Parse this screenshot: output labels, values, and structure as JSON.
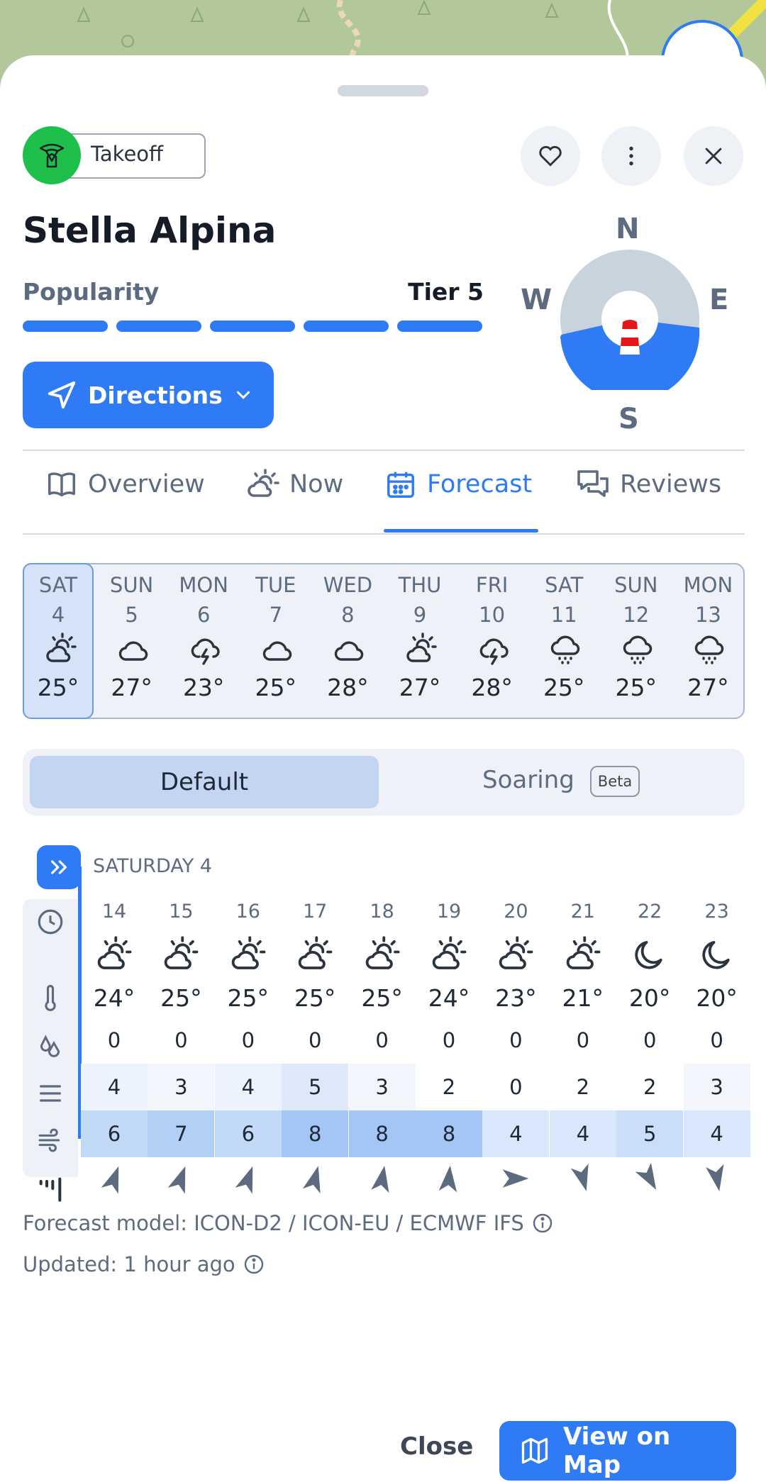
{
  "header": {
    "badge_label": "Takeoff",
    "badge_icon": "paraglider-icon",
    "title": "Stella Alpina"
  },
  "popularity": {
    "label": "Popularity",
    "tier": "Tier 5",
    "level": 5,
    "max": 5
  },
  "directions_label": "Directions",
  "compass": {
    "n": "N",
    "e": "E",
    "s": "S",
    "w": "W",
    "flyable_sectors": "SE-S-SW"
  },
  "tabs": [
    {
      "label": "Overview",
      "icon": "book-icon"
    },
    {
      "label": "Now",
      "icon": "partly-cloudy-icon"
    },
    {
      "label": "Forecast",
      "icon": "calendar-icon",
      "active": true
    },
    {
      "label": "Reviews",
      "icon": "chat-icon"
    }
  ],
  "days": [
    {
      "name": "SAT",
      "date": "4",
      "icon": "partly-sunny",
      "temp": "25°",
      "selected": true
    },
    {
      "name": "SUN",
      "date": "5",
      "icon": "cloud",
      "temp": "27°"
    },
    {
      "name": "MON",
      "date": "6",
      "icon": "thunder",
      "temp": "23°"
    },
    {
      "name": "TUE",
      "date": "7",
      "icon": "cloud",
      "temp": "25°"
    },
    {
      "name": "WED",
      "date": "8",
      "icon": "cloud",
      "temp": "28°"
    },
    {
      "name": "THU",
      "date": "9",
      "icon": "partly-sunny",
      "temp": "27°"
    },
    {
      "name": "FRI",
      "date": "10",
      "icon": "thunder",
      "temp": "28°"
    },
    {
      "name": "SAT",
      "date": "11",
      "icon": "rain",
      "temp": "25°"
    },
    {
      "name": "SUN",
      "date": "12",
      "icon": "rain",
      "temp": "25°"
    },
    {
      "name": "MON",
      "date": "13",
      "icon": "rain",
      "temp": "27°"
    }
  ],
  "segment": {
    "default_label": "Default",
    "soaring_label": "Soaring",
    "beta_label": "Beta"
  },
  "hourly": {
    "day_heading": "SATURDAY 4",
    "hours": [
      "14",
      "15",
      "16",
      "17",
      "18",
      "19",
      "20",
      "21",
      "22",
      "23"
    ],
    "icons": [
      "partly-sunny",
      "partly-sunny",
      "partly-sunny",
      "partly-sunny",
      "partly-sunny",
      "partly-sunny",
      "partly-sunny",
      "partly-sunny",
      "moon",
      "moon"
    ],
    "temps": [
      "24°",
      "25°",
      "25°",
      "25°",
      "25°",
      "24°",
      "23°",
      "21°",
      "20°",
      "20°"
    ],
    "precip": [
      "0",
      "0",
      "0",
      "0",
      "0",
      "0",
      "0",
      "0",
      "0",
      "0"
    ],
    "wind_layer": [
      "4",
      "3",
      "4",
      "5",
      "3",
      "2",
      "0",
      "2",
      "2",
      "3"
    ],
    "wind_speed": [
      "6",
      "7",
      "6",
      "8",
      "8",
      "8",
      "4",
      "4",
      "5",
      "4"
    ],
    "wind_dir_deg": [
      20,
      20,
      20,
      15,
      10,
      5,
      90,
      165,
      150,
      170
    ]
  },
  "forecast_model": "Forecast model: ICON-D2 / ICON-EU / ECMWF IFS",
  "updated": "Updated: 1 hour ago",
  "close_label": "Close",
  "view_map_label": "View on Map"
}
